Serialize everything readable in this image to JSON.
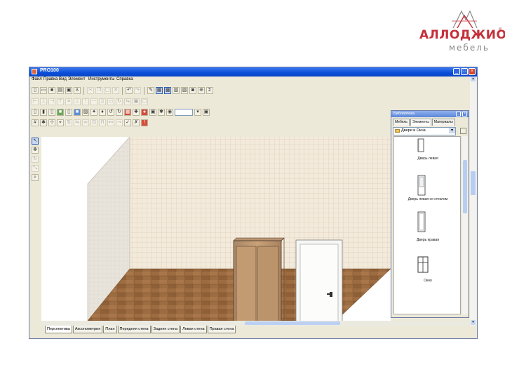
{
  "brand": {
    "name": "АЛЛОДЖИО",
    "registered": "®",
    "subtitle": "мебель"
  },
  "window": {
    "title": "PRO100",
    "menu": [
      "Файл",
      "Правка",
      "Вид",
      "Элемент",
      "Инструменты",
      "Справка"
    ]
  },
  "library": {
    "title": "Библиотека",
    "tabs": [
      "Мебель",
      "Элементы",
      "Материалы"
    ],
    "folder": "Двери и Окна",
    "items": [
      {
        "label": "Дверь левая"
      },
      {
        "label": "Дверь левая со стеклом"
      },
      {
        "label": "Дверь правая"
      },
      {
        "label": "Окно"
      }
    ]
  },
  "tabs": [
    "Перспектива",
    "Аксонометрия",
    "План",
    "Передняя стена",
    "Задняя стена",
    "Левая стена",
    "Правая стена"
  ],
  "colors": {
    "titlebar": "#0a4ed8",
    "brand": "#c3303a",
    "floor": "#9a6b3f",
    "wall": "#f1e6d6"
  },
  "icons": [
    "new-file-icon",
    "open-folder-icon",
    "save-icon",
    "print-icon",
    "cut-icon",
    "copy-icon",
    "paste-icon",
    "undo-icon",
    "redo-icon",
    "zoom-icon",
    "sum-icon",
    "select-arrow-icon",
    "magnifier-icon"
  ]
}
